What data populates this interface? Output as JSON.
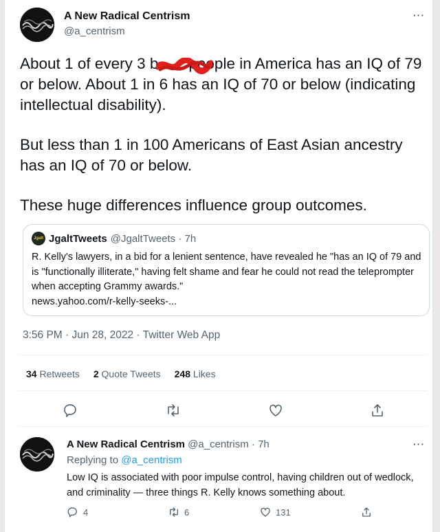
{
  "tweet": {
    "author_name": "A New Radical Centrism",
    "author_handle": "@a_centrism",
    "paragraph1_a": "About 1 of every 3 b",
    "paragraph1_b": "people in America has an IQ of 79 or below. About 1 in 6 has an IQ of 70 or below (indicating intellectual disability).",
    "paragraph2": "But less than 1 in 100 Americans of East Asian ancestry has an IQ of 70 or below.",
    "paragraph3": "These huge differences influence group outcomes.",
    "timestamp": "3:56 PM · Jun 28, 2022 · Twitter Web App",
    "retweets_count": "34",
    "retweets_label": "Retweets",
    "quotes_count": "2",
    "quotes_label": "Quote Tweets",
    "likes_count": "248",
    "likes_label": "Likes"
  },
  "quoted": {
    "avatar_text": "Jgalt",
    "name": "JgaltTweets",
    "handle_time": "@JgaltTweets · 7h",
    "text": "R. Kelly's lawyers, in a bid for a lenient sentence, have revealed he \"has an IQ of 79 and is \"functionally illiterate,\" having felt shame and fear he could not read the teleprompter when accepting Grammy awards.\"",
    "link": "news.yahoo.com/r-kelly-seeks-..."
  },
  "reply": {
    "author_name": "A New Radical Centrism",
    "handle_time": "@a_centrism · 7h",
    "replying_prefix": "Replying to",
    "replying_to": "@a_centrism",
    "text": "Low IQ is associated with poor impulse control, having children out of wedlock, and criminality — three things R. Kelly knows something about.",
    "reply_count": "4",
    "retweet_count": "6",
    "like_count": "131"
  },
  "more_label": "···",
  "icons": [
    "reply-icon",
    "retweet-icon",
    "like-icon",
    "share-icon",
    "more-icon"
  ],
  "colors": {
    "link": "#1d9bf0",
    "redaction": "#e0201c"
  }
}
